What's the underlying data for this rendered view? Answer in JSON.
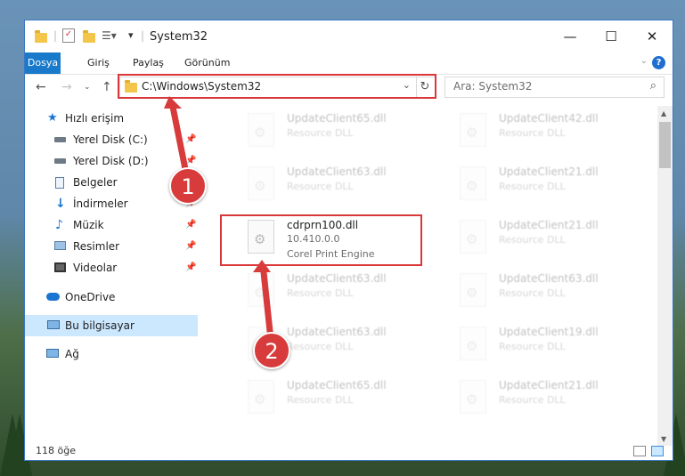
{
  "window": {
    "title": "System32",
    "controls": {
      "minimize": "—",
      "maximize": "☐",
      "close": "✕"
    }
  },
  "ribbon": {
    "tabs": [
      "Dosya",
      "Giriş",
      "Paylaş",
      "Görünüm"
    ],
    "help": "?"
  },
  "nav": {
    "address": "C:\\Windows\\System32",
    "search_placeholder": "Ara: System32"
  },
  "sidebar": {
    "items": [
      {
        "label": "Hızlı erişim",
        "icon": "star-icon",
        "pinned": false
      },
      {
        "label": "Yerel Disk (C:)",
        "icon": "drive-icon",
        "pinned": true
      },
      {
        "label": "Yerel Disk (D:)",
        "icon": "drive-icon",
        "pinned": true
      },
      {
        "label": "Belgeler",
        "icon": "documents-icon",
        "pinned": true
      },
      {
        "label": "İndirmeler",
        "icon": "download-icon",
        "pinned": true
      },
      {
        "label": "Müzik",
        "icon": "music-icon",
        "pinned": true
      },
      {
        "label": "Resimler",
        "icon": "pictures-icon",
        "pinned": true
      },
      {
        "label": "Videolar",
        "icon": "videos-icon",
        "pinned": true
      },
      {
        "label": "OneDrive",
        "icon": "cloud-icon",
        "pinned": false
      },
      {
        "label": "Bu bilgisayar",
        "icon": "computer-icon",
        "pinned": false
      },
      {
        "label": "Ağ",
        "icon": "network-icon",
        "pinned": false
      }
    ]
  },
  "files": {
    "left": [
      {
        "name": "UpdateClient65.dll",
        "type": "Resource DLL"
      },
      {
        "name": "UpdateClient63.dll",
        "type": "Resource DLL"
      },
      {
        "name": "cdrprn100.dll",
        "version": "10.410.0.0",
        "type": "Corel Print Engine"
      },
      {
        "name": "UpdateClient63.dll",
        "type": "Resource DLL"
      },
      {
        "name": "UpdateClient63.dll",
        "type": "Resource DLL"
      },
      {
        "name": "UpdateClient65.dll",
        "type": "Resource DLL"
      }
    ],
    "right": [
      {
        "name": "UpdateClient42.dll",
        "type": "Resource DLL"
      },
      {
        "name": "UpdateClient21.dll",
        "type": "Resource DLL"
      },
      {
        "name": "UpdateClient21.dll",
        "type": "Resource DLL"
      },
      {
        "name": "UpdateClient63.dll",
        "type": "Resource DLL"
      },
      {
        "name": "UpdateClient19.dll",
        "type": "Resource DLL"
      },
      {
        "name": "UpdateClient21.dll",
        "type": "Resource DLL"
      }
    ]
  },
  "status": {
    "count": "118 öğe"
  },
  "callouts": {
    "one": "1",
    "two": "2"
  },
  "colors": {
    "accent": "#1979ca",
    "highlight": "#d9383a",
    "selected": "#cce8ff"
  }
}
